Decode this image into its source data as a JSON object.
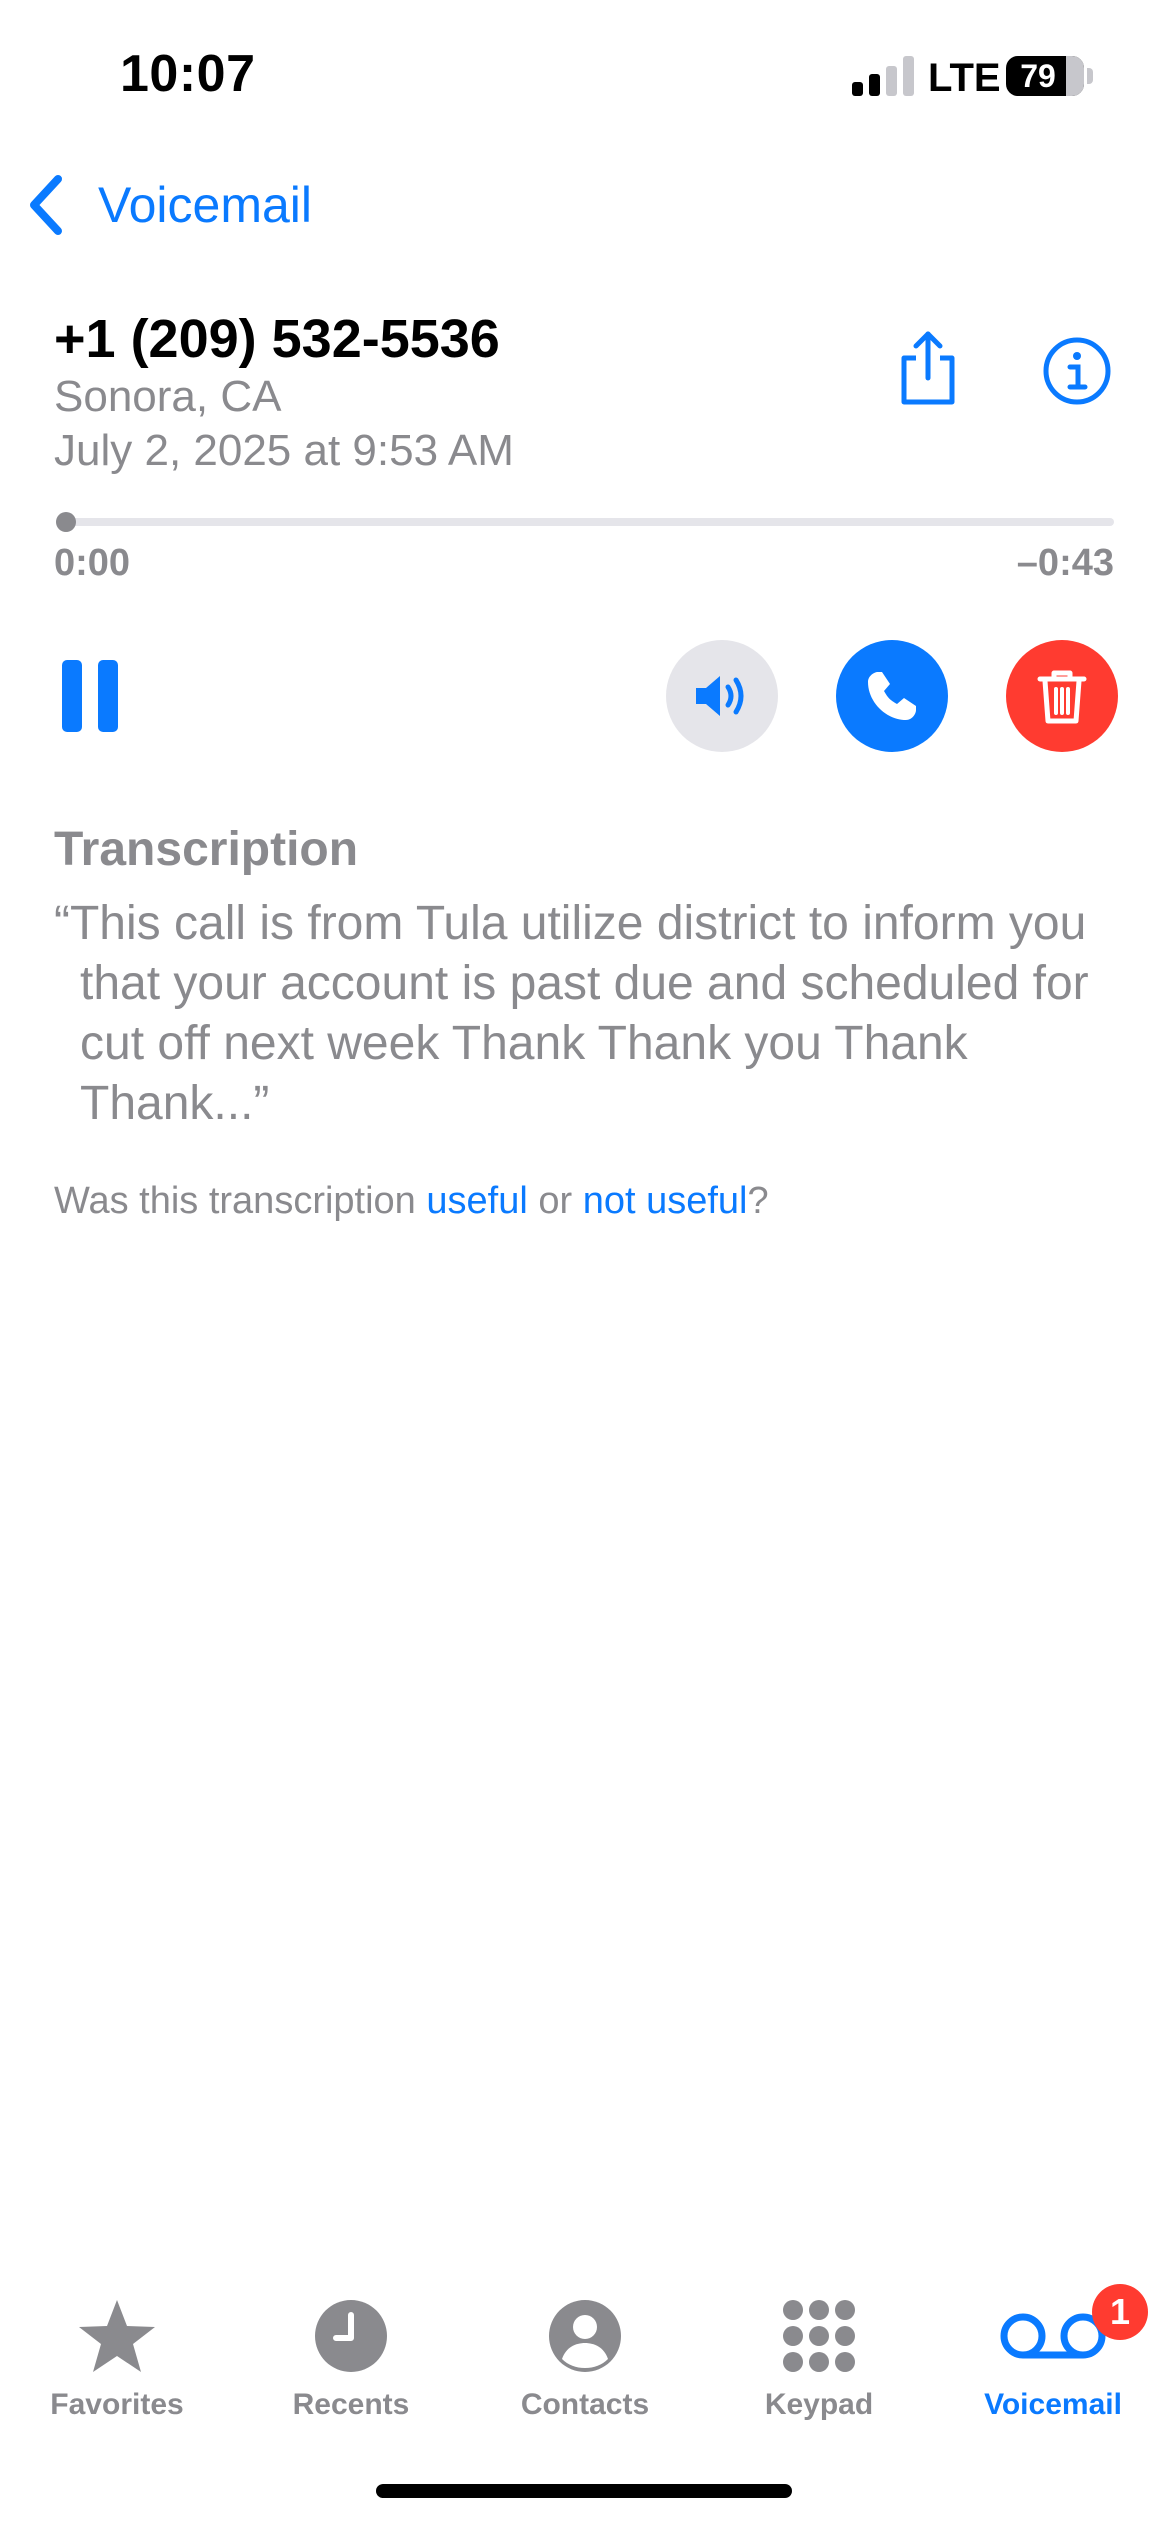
{
  "status_bar": {
    "time": "10:07",
    "network": "LTE",
    "battery_percent": "79",
    "signal_bars_active": 2,
    "signal_bars_total": 4
  },
  "nav": {
    "back_label": "Voicemail",
    "back_icon": "chevron-left-icon"
  },
  "caller": {
    "number": "+1 (209) 532-5536",
    "location": "Sonora, CA",
    "date": "July 2, 2025 at 9:53 AM"
  },
  "actions": {
    "share_icon": "share-icon",
    "info_icon": "info-icon"
  },
  "playback": {
    "elapsed": "0:00",
    "remaining": "–0:43",
    "progress": 0
  },
  "controls": {
    "pause_icon": "pause-icon",
    "speaker_icon": "speaker-icon",
    "call_icon": "phone-icon",
    "delete_icon": "trash-icon"
  },
  "transcription": {
    "title": "Transcription",
    "text": "“This call is from Tula utilize district to inform you that your account is past due and scheduled for cut off next week Thank Thank you Thank Thank...”",
    "feedback_prefix": "Was this transcription ",
    "useful_link": "useful",
    "feedback_middle": " or ",
    "not_useful_link": "not useful",
    "feedback_suffix": "?"
  },
  "tabs": [
    {
      "label": "Favorites",
      "icon": "star-icon",
      "active": false
    },
    {
      "label": "Recents",
      "icon": "clock-icon",
      "active": false
    },
    {
      "label": "Contacts",
      "icon": "person-icon",
      "active": false
    },
    {
      "label": "Keypad",
      "icon": "keypad-icon",
      "active": false
    },
    {
      "label": "Voicemail",
      "icon": "voicemail-icon",
      "active": true
    }
  ],
  "voicemail_badge": "1",
  "colors": {
    "accent": "#0a7aff",
    "secondary_text": "#8a8a8e",
    "destructive": "#ff3b30",
    "speaker_bg": "#e5e5ea"
  }
}
